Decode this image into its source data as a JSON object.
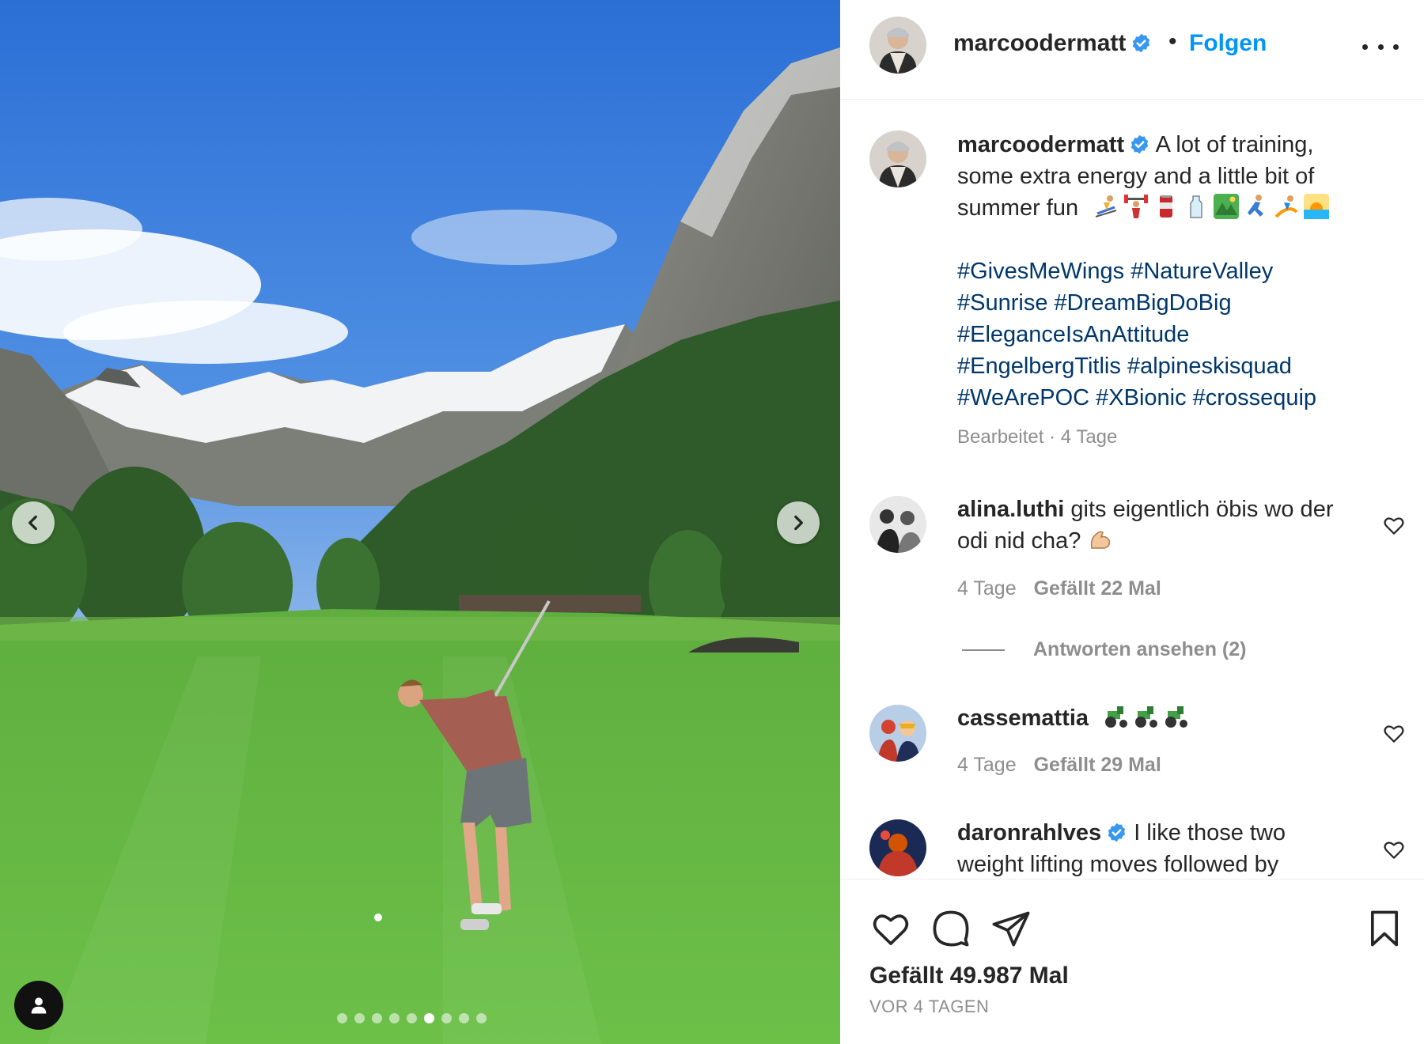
{
  "post": {
    "username": "marcoodermatt",
    "verified": true,
    "separator": "•",
    "follow_label": "Folgen",
    "more_icon": "more-horizontal-icon",
    "photo": {
      "subject": "golfer swinging on a fairway in an alpine valley",
      "current_slide": 6,
      "total_slides": 9
    }
  },
  "caption": {
    "username": "marcoodermatt",
    "text": "A lot of training, some extra energy and a little bit of summer fun",
    "emojis": [
      "skier",
      "weight-lifter",
      "energy-drink-can",
      "bottle",
      "national-park",
      "runner",
      "surfer",
      "sunrise"
    ],
    "hashtags": [
      "#GivesMeWings",
      "#NatureValley",
      "#Sunrise",
      "#DreamBigDoBig",
      "#EleganceIsAnAttitude",
      "#EngelbergTitlis",
      "#alpineskisquad",
      "#WeArePOC",
      "#XBionic",
      "#crossequip"
    ],
    "meta": "Bearbeitet · 4 Tage"
  },
  "comments": [
    {
      "username": "alina.luthi",
      "verified": false,
      "text": "gits eigentlich öbis wo der odi nid cha?",
      "emoji": "flexed-biceps",
      "time": "4 Tage",
      "likes": "Gefällt 22 Mal",
      "replies": "Antworten ansehen (2)"
    },
    {
      "username": "cassemattia",
      "verified": false,
      "text": "",
      "emojis": [
        "tractor",
        "tractor",
        "tractor"
      ],
      "time": "4 Tage",
      "likes": "Gefällt 29 Mal"
    },
    {
      "username": "daronrahlves",
      "verified": true,
      "text": "I like those two weight lifting moves followed by"
    }
  ],
  "footer": {
    "likes": "Gefällt 49.987 Mal",
    "date": "VOR 4 TAGEN"
  },
  "colors": {
    "link_blue": "#0095f6",
    "hashtag_blue": "#00376b",
    "muted_gray": "#8e8e8e",
    "text": "#262626",
    "verified_blue": "#3897f0"
  }
}
